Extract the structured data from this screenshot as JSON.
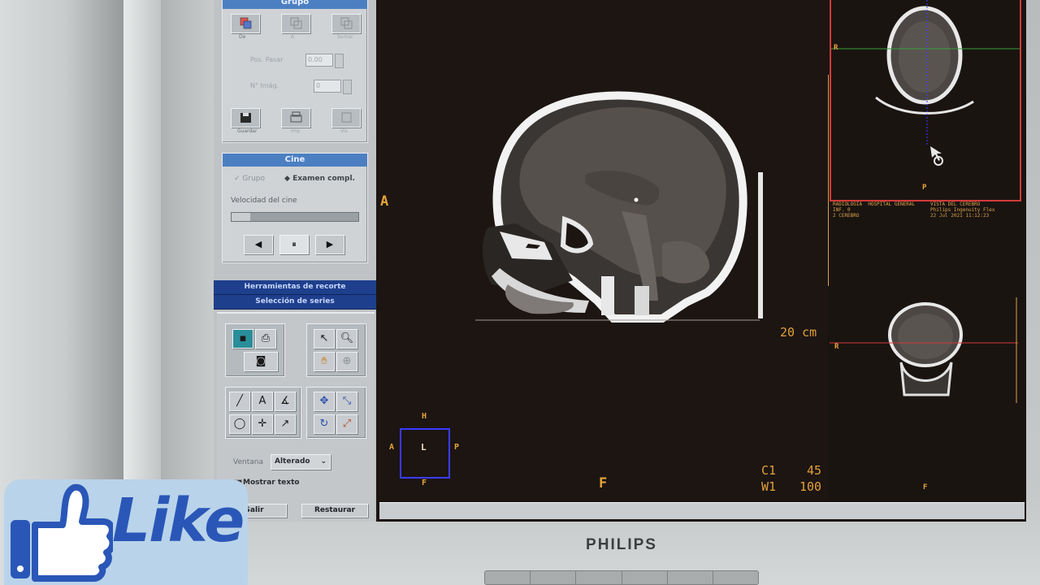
{
  "panel": {
    "group_header": "Grupo",
    "group_buttons": [
      "De",
      "A",
      "Sumar"
    ],
    "pos_label": "Pos. Pasar",
    "pos_value": "0.00",
    "num_label": "N° Imág.",
    "num_value": "0",
    "action_buttons": [
      "Guardar",
      "Imp",
      "Vis"
    ],
    "cine_header": "Cine",
    "cine_option_group": "Grupo",
    "cine_option_exam": "Examen compl.",
    "cine_speed_label": "Velocidad del cine",
    "cine_speed": 0.15,
    "cine_prev": "◀",
    "cine_pause": "⏸",
    "cine_next": "▶",
    "bar_recorte": "Herramientas de recorte",
    "bar_series": "Selección de series",
    "ventana_label": "Ventana",
    "ventana_value": "Alterado",
    "show_text_label": "Mostrar texto",
    "exit_button": "Salir",
    "reset_button": "Restaurar"
  },
  "viewer": {
    "orient_anterior": "A",
    "orient_foot": "F",
    "scale_label": "20 cm",
    "wl_c_label": "C1",
    "wl_c_value": "45",
    "wl_w_label": "W1",
    "wl_w_value": "100",
    "locator_h": "H",
    "locator_a": "A",
    "locator_l": "L",
    "locator_p": "P",
    "locator_f": "F"
  },
  "thumbs": {
    "axial_r": "R",
    "axial_p": "P",
    "axial_meta": "RADIOLOGIA  HOSPITAL GENERAL\nINF. 0\n2 CEREBRO",
    "axial_meta_right": "VISTA DEL CEREBRO\nPhilips Ingenuity Flex\n22 Jul 2021 11:12:23",
    "coronal_r": "R",
    "bottom_f": "F"
  },
  "monitor": {
    "brand": "PHILIPS"
  },
  "overlay": {
    "like_text": "Like"
  },
  "colors": {
    "panel_header": "#4c7fc2",
    "panel_bar": "#1e3f8c",
    "screen_bg": "#1c1512",
    "orientation": "#e6a33a",
    "locator_box": "#3a3cff",
    "axial_frame": "#d33a3a",
    "like_blue": "#2a57b7"
  }
}
